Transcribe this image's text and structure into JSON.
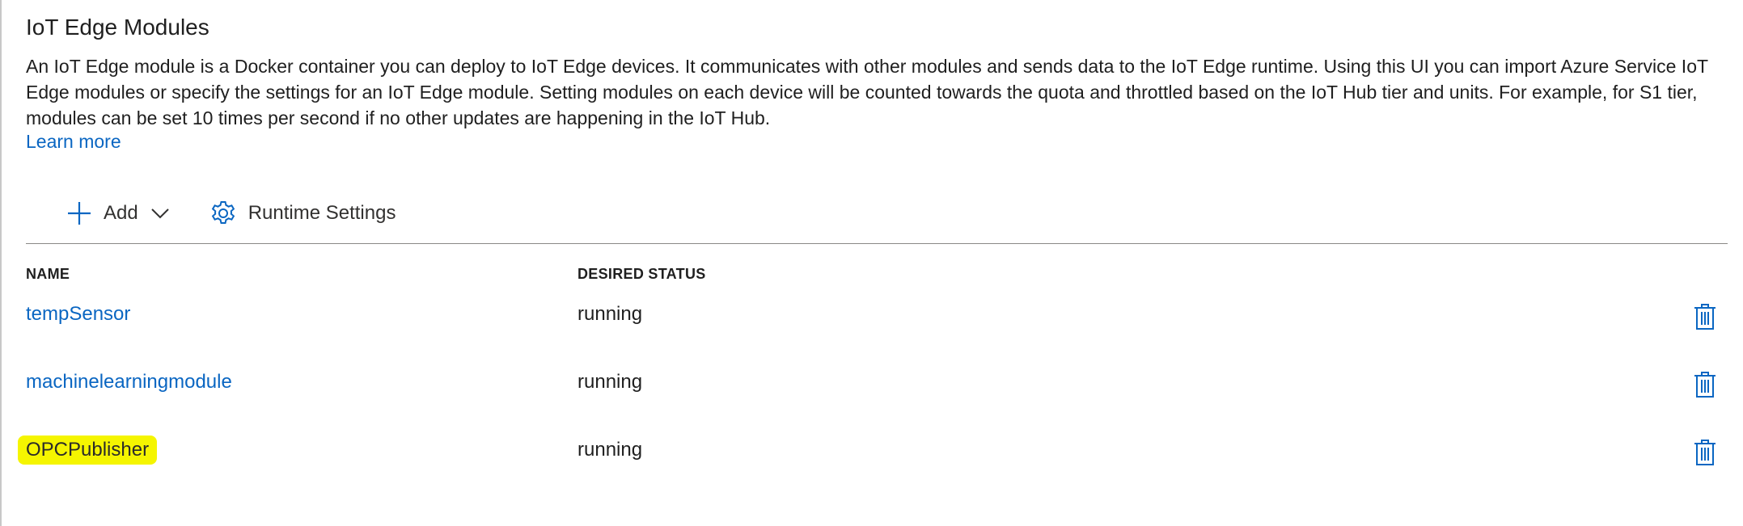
{
  "header": {
    "title": "IoT Edge Modules",
    "description": "An IoT Edge module is a Docker container you can deploy to IoT Edge devices. It communicates with other modules and sends data to the IoT Edge runtime. Using this UI you can import Azure Service IoT Edge modules or specify the settings for an IoT Edge module. Setting modules on each device will be counted towards the quota and throttled based on the IoT Hub tier and units. For example, for S1 tier, modules can be set 10 times per second if no other updates are happening in the IoT Hub.",
    "learn_more": "Learn more"
  },
  "toolbar": {
    "add_label": "Add",
    "add_icon": "plus-icon",
    "add_dropdown_icon": "chevron-down-icon",
    "runtime_label": "Runtime Settings",
    "runtime_icon": "gear-icon"
  },
  "table": {
    "columns": [
      "NAME",
      "DESIRED STATUS"
    ],
    "rows": [
      {
        "name": "tempSensor",
        "status": "running",
        "action_icon": "trash-icon"
      },
      {
        "name": "machinelearningmodule",
        "status": "running",
        "action_icon": "trash-icon"
      },
      {
        "name": "OPCPublisher",
        "status": "running",
        "action_icon": "trash-icon",
        "highlighted": true
      }
    ]
  },
  "colors": {
    "link": "#0a66c2",
    "highlight": "#f5f500",
    "text": "#1f1f1f"
  }
}
